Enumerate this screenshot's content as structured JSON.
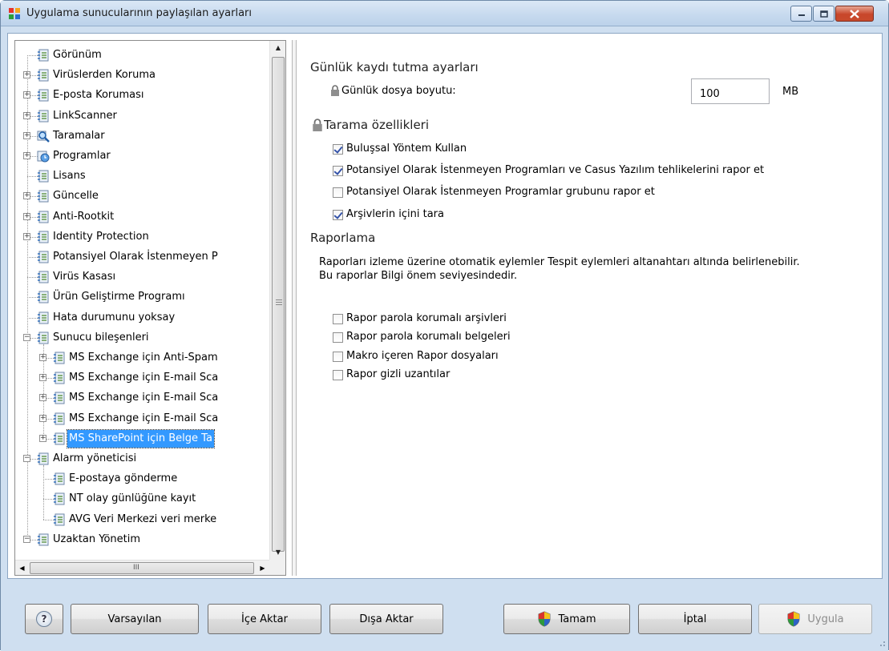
{
  "window": {
    "title": "Uygulama sunucularının paylaşılan ayarları"
  },
  "tree": {
    "items": [
      {
        "label": "Görünüm",
        "icon": "settings-page-icon",
        "expandable": false
      },
      {
        "label": "Virüslerden Koruma",
        "icon": "settings-page-icon",
        "expandable": true
      },
      {
        "label": "E-posta Koruması",
        "icon": "settings-page-icon",
        "expandable": true
      },
      {
        "label": "LinkScanner",
        "icon": "settings-page-icon",
        "expandable": true
      },
      {
        "label": "Taramalar",
        "icon": "magnifier-icon",
        "expandable": true
      },
      {
        "label": "Programlar",
        "icon": "schedule-icon",
        "expandable": true
      },
      {
        "label": "Lisans",
        "icon": "settings-page-icon",
        "expandable": false
      },
      {
        "label": "Güncelle",
        "icon": "settings-page-icon",
        "expandable": true
      },
      {
        "label": "Anti-Rootkit",
        "icon": "settings-page-icon",
        "expandable": true
      },
      {
        "label": "Identity Protection",
        "icon": "settings-page-icon",
        "expandable": true
      },
      {
        "label": "Potansiyel Olarak İstenmeyen P",
        "icon": "settings-page-icon",
        "expandable": false
      },
      {
        "label": "Virüs Kasası",
        "icon": "settings-page-icon",
        "expandable": false
      },
      {
        "label": "Ürün Geliştirme Programı",
        "icon": "settings-page-icon",
        "expandable": false
      },
      {
        "label": "Hata durumunu yoksay",
        "icon": "settings-page-icon",
        "expandable": false
      },
      {
        "label": "Sunucu bileşenleri",
        "icon": "settings-page-icon",
        "expandable": true,
        "expanded": true
      },
      {
        "label": "MS Exchange için Anti-Spam",
        "icon": "settings-page-icon",
        "expandable": true
      },
      {
        "label": "MS Exchange için E-mail Sca",
        "icon": "settings-page-icon",
        "expandable": true
      },
      {
        "label": "MS Exchange için E-mail Sca",
        "icon": "settings-page-icon",
        "expandable": true
      },
      {
        "label": "MS Exchange için E-mail Sca",
        "icon": "settings-page-icon",
        "expandable": true
      },
      {
        "label": "MS SharePoint için Belge Ta",
        "icon": "settings-page-icon",
        "expandable": true,
        "selected": true
      },
      {
        "label": "Alarm yöneticisi",
        "icon": "settings-page-icon",
        "expandable": true,
        "expanded": true
      },
      {
        "label": "E-postaya gönderme",
        "icon": "settings-page-icon",
        "expandable": false
      },
      {
        "label": "NT olay günlüğüne kayıt",
        "icon": "settings-page-icon",
        "expandable": false
      },
      {
        "label": "AVG Veri Merkezi veri merke",
        "icon": "settings-page-icon",
        "expandable": false
      },
      {
        "label": "Uzaktan Yönetim",
        "icon": "settings-page-icon",
        "expandable": true,
        "expanded": true
      }
    ],
    "hscroll_grip": "III"
  },
  "logging": {
    "title": "Günlük kaydı tutma ayarları",
    "size_label": "Günlük dosya boyutu:",
    "size_value": "100",
    "size_unit": "MB"
  },
  "scan": {
    "title": "Tarama özellikleri",
    "options": [
      {
        "label": "Buluşsal Yöntem Kullan",
        "checked": true
      },
      {
        "label": "Potansiyel Olarak İstenmeyen Programları ve Casus Yazılım tehlikelerini rapor et",
        "checked": true
      },
      {
        "label": "Potansiyel Olarak İstenmeyen Programlar grubunu rapor et",
        "checked": false
      },
      {
        "label": "Arşivlerin içini tara",
        "checked": true
      }
    ]
  },
  "reporting": {
    "title": "Raporlama",
    "description": "Raporları izleme üzerine otomatik eylemler Tespit eylemleri altanahtarı altında belirlenebilir. Bu raporlar Bilgi önem seviyesindedir.",
    "options": [
      {
        "label": "Rapor parola korumalı arşivleri",
        "checked": false
      },
      {
        "label": "Rapor parola korumalı belgeleri",
        "checked": false
      },
      {
        "label": "Makro içeren Rapor dosyaları",
        "checked": false
      },
      {
        "label": "Rapor gizli uzantılar",
        "checked": false
      }
    ]
  },
  "buttons": {
    "help": "?",
    "defaults": "Varsayılan",
    "import": "İçe Aktar",
    "export": "Dışa Aktar",
    "ok": "Tamam",
    "cancel": "İptal",
    "apply": "Uygula"
  },
  "colors": {
    "selection": "#3399ff",
    "frame": "#cfdff0",
    "close_button": "#c8462a"
  }
}
